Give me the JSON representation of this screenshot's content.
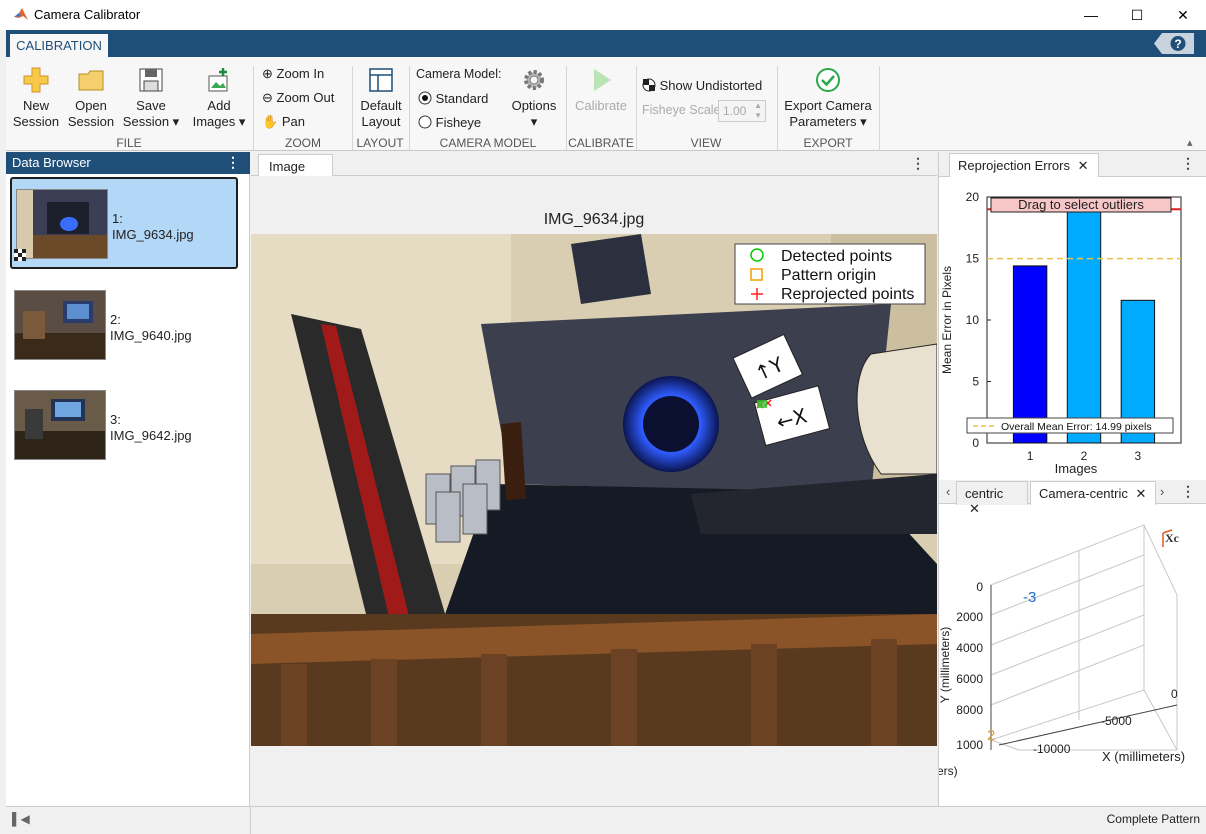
{
  "window": {
    "title": "Camera Calibrator"
  },
  "toolstrip": {
    "tab": "CALIBRATION",
    "help": "?",
    "file": {
      "section": "FILE",
      "new_session": [
        "New",
        "Session"
      ],
      "open_session": [
        "Open",
        "Session"
      ],
      "save_session": [
        "Save",
        "Session"
      ],
      "add_images": [
        "Add",
        "Images"
      ]
    },
    "zoom": {
      "section": "ZOOM",
      "zoom_in": "Zoom In",
      "zoom_out": "Zoom Out",
      "pan": "Pan"
    },
    "layout": {
      "section": "LAYOUT",
      "default_layout": [
        "Default",
        "Layout"
      ]
    },
    "camera_model": {
      "section": "CAMERA MODEL",
      "label": "Camera Model:",
      "standard": "Standard",
      "fisheye": "Fisheye",
      "options": "Options",
      "selected": "Standard"
    },
    "calibrate": {
      "section": "CALIBRATE",
      "calibrate": "Calibrate"
    },
    "view": {
      "section": "VIEW",
      "show_undistorted": "Show Undistorted",
      "fisheye_scale_label": "Fisheye Scale",
      "fisheye_scale_value": "1.00"
    },
    "export": {
      "section": "EXPORT",
      "export_params": [
        "Export Camera",
        "Parameters"
      ]
    }
  },
  "data_browser": {
    "title": "Data Browser",
    "items": [
      {
        "index": "1:",
        "name": "IMG_9634.jpg",
        "selected": true
      },
      {
        "index": "2:",
        "name": "IMG_9640.jpg",
        "selected": false
      },
      {
        "index": "3:",
        "name": "IMG_9642.jpg",
        "selected": false
      }
    ]
  },
  "image_panel": {
    "tab": "Image",
    "image_title": "IMG_9634.jpg",
    "legend": [
      "Detected points",
      "Pattern origin",
      "Reprojected points"
    ],
    "card_y": "↑Y",
    "card_x": "←X"
  },
  "reprojection": {
    "tab": "Reprojection Errors",
    "drag_label": "Drag to select outliers",
    "mean_label": "Overall Mean Error: 14.99 pixels"
  },
  "extrinsics": {
    "tab_partial": "centric",
    "tab_active": "Camera-centric",
    "ylabel": "Y (millimeters)",
    "xlabel": "X (millimeters)",
    "zlabel_partial": "ers)",
    "yticks": [
      "0",
      "2000",
      "4000",
      "6000",
      "8000",
      "1000"
    ],
    "xticks": [
      "-10000",
      "-5000",
      "0"
    ],
    "marker_3": "-3",
    "marker_2": "2",
    "axis_label": "Xc"
  },
  "status": {
    "text": "Complete Pattern"
  },
  "chart_data": {
    "type": "bar",
    "categories": [
      "1",
      "2",
      "3"
    ],
    "values": [
      14.4,
      19.0,
      11.6
    ],
    "colors": [
      "#0000ff",
      "#00aaff",
      "#00aaff"
    ],
    "mean": 14.99,
    "threshold": 19.0,
    "xlabel": "Images",
    "ylabel": "Mean Error in Pixels",
    "ylim": [
      0,
      20
    ],
    "yticks": [
      0,
      5,
      10,
      15,
      20
    ]
  }
}
